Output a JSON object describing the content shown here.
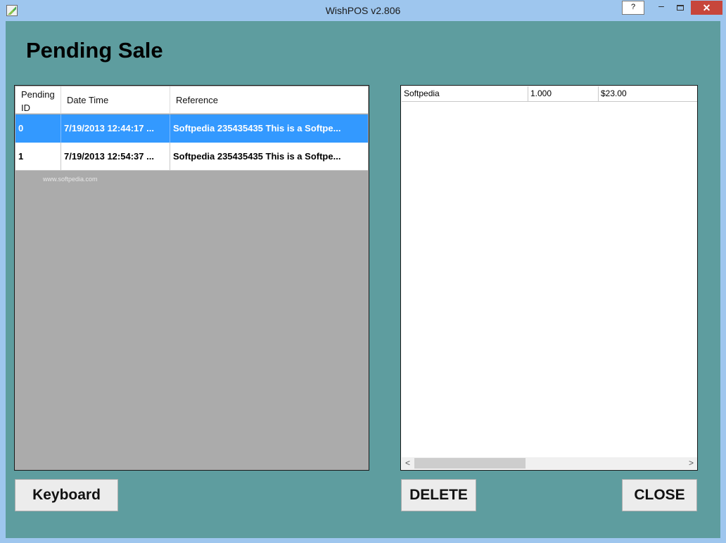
{
  "window": {
    "title": "WishPOS v2.806",
    "help_label": "?",
    "minimize_label": "–",
    "close_label": "✕"
  },
  "page": {
    "title": "Pending Sale"
  },
  "pending_grid": {
    "headers": {
      "id_line1": "Pending",
      "id_line2": "ID",
      "date": "Date Time",
      "reference": "Reference"
    },
    "rows": [
      {
        "id": "0",
        "date": "7/19/2013 12:44:17 ...",
        "reference": "Softpedia 235435435 This is a Softpe...",
        "selected": true
      },
      {
        "id": "1",
        "date": "7/19/2013 12:54:37 ...",
        "reference": "Softpedia  235435435 This is a Softpe...",
        "selected": false
      }
    ],
    "watermark": "www.softpedia.com"
  },
  "items_grid": {
    "rows": [
      {
        "name": "Softpedia",
        "qty": "1.000",
        "price": "$23.00"
      }
    ],
    "scroll_left": "<",
    "scroll_right": ">"
  },
  "buttons": {
    "keyboard": "Keyboard",
    "delete": "DELETE",
    "close": "CLOSE"
  },
  "colors": {
    "client_background": "#5e9d9f",
    "selection": "#3399ff",
    "window_frame": "#9ec6ee",
    "close_button": "#c7463b"
  }
}
